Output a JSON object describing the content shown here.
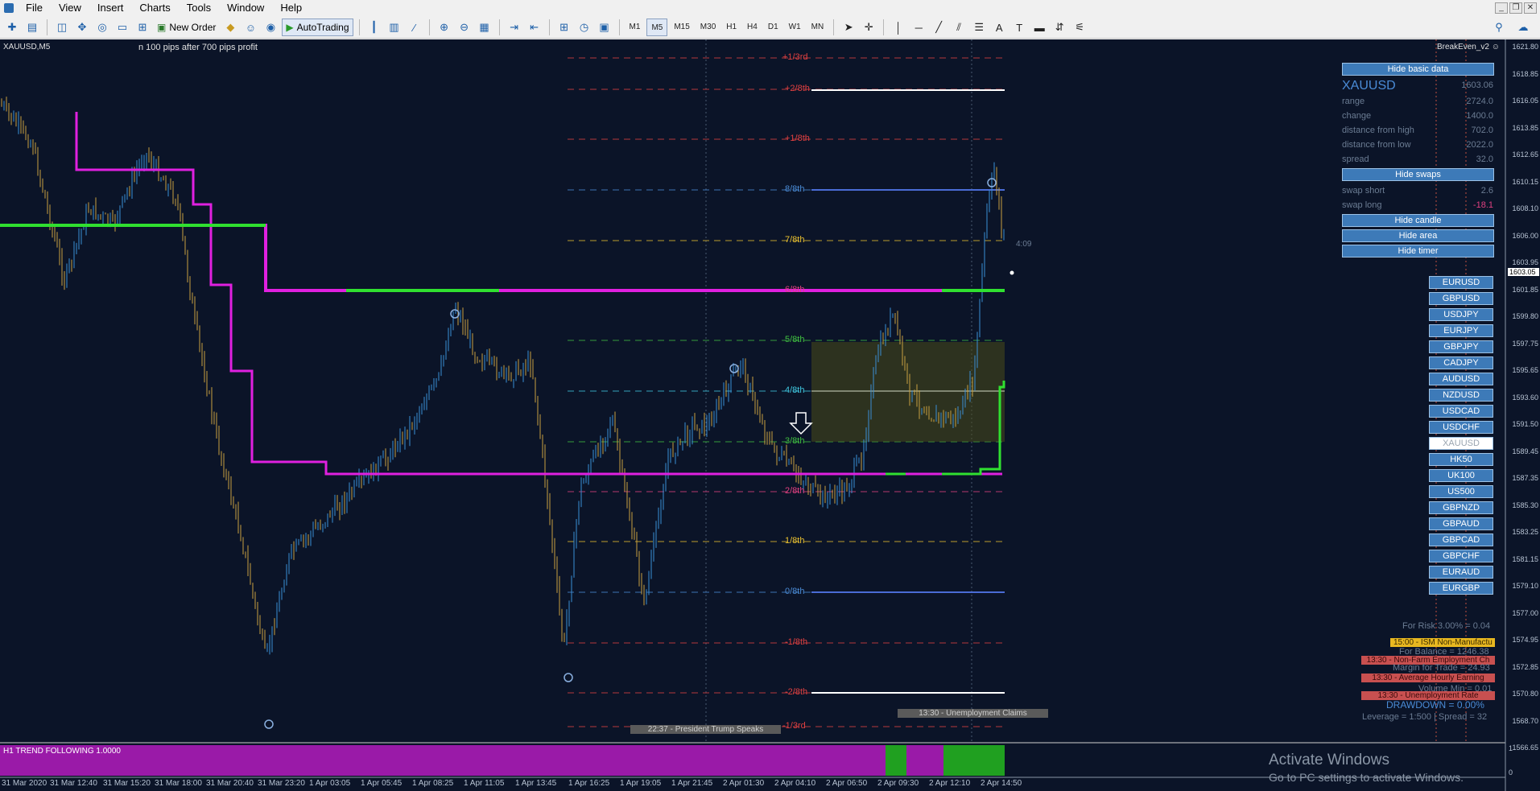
{
  "menu": {
    "items": [
      "File",
      "View",
      "Insert",
      "Charts",
      "Tools",
      "Window",
      "Help"
    ]
  },
  "toolbar": {
    "new_order_label": "New Order",
    "autotrading_label": "AutoTrading",
    "timeframes": [
      "M1",
      "M5",
      "M15",
      "M30",
      "H1",
      "H4",
      "D1",
      "W1",
      "MN"
    ],
    "active_timeframe": "M5",
    "drawing_tool_letter": "A"
  },
  "chart": {
    "symbol_label": "XAUUSD,M5",
    "note": "n 100 pips after 700 pips profit",
    "indicator_name": "BreakEven_v2",
    "candle_timer": "4:09",
    "subwindow_label": "H1 TREND FOLLOWING 1.0000",
    "subwindow_scale_top": "1",
    "subwindow_scale_bottom": "0",
    "price_axis": [
      "1621.80",
      "1618.85",
      "1616.05",
      "1613.85",
      "1612.65",
      "1610.15",
      "1608.10",
      "1606.00",
      "1603.95",
      "1601.85",
      "1599.80",
      "1597.75",
      "1595.65",
      "1593.60",
      "1591.50",
      "1589.45",
      "1587.35",
      "1585.30",
      "1583.25",
      "1581.15",
      "1579.10",
      "1577.00",
      "1574.95",
      "1572.85",
      "1570.80",
      "1568.70",
      "1566.65"
    ],
    "current_price": "1603.05",
    "time_axis": [
      "31 Mar 2020",
      "31 Mar 12:40",
      "31 Mar 15:20",
      "31 Mar 18:00",
      "31 Mar 20:40",
      "31 Mar 23:20",
      "1 Apr 03:05",
      "1 Apr 05:45",
      "1 Apr 08:25",
      "1 Apr 11:05",
      "1 Apr 13:45",
      "1 Apr 16:25",
      "1 Apr 19:05",
      "1 Apr 21:45",
      "2 Apr 01:30",
      "2 Apr 04:10",
      "2 Apr 06:50",
      "2 Apr 09:30",
      "2 Apr 12:10",
      "2 Apr 14:50"
    ],
    "murrey_levels": [
      {
        "label": "+1/3rd",
        "color": "#e04040"
      },
      {
        "label": "+2/8th",
        "color": "#e04040"
      },
      {
        "label": "+1/8th",
        "color": "#e04040"
      },
      {
        "label": "8/8th",
        "color": "#4a8bd6"
      },
      {
        "label": "7/8th",
        "color": "#e8c030"
      },
      {
        "label": "6/8th",
        "color": "#e04080"
      },
      {
        "label": "5/8th",
        "color": "#40c040"
      },
      {
        "label": "4/8th",
        "color": "#40c8e0"
      },
      {
        "label": "3/8th",
        "color": "#40c040"
      },
      {
        "label": "2/8th",
        "color": "#e04080"
      },
      {
        "label": "1/8th",
        "color": "#e8c030"
      },
      {
        "label": "0/8th",
        "color": "#4a8bd6"
      },
      {
        "label": "-1/8th",
        "color": "#e04040"
      },
      {
        "label": "-2/8th",
        "color": "#e04040"
      },
      {
        "label": "-1/3rd",
        "color": "#e04040"
      }
    ],
    "news": {
      "trump": "22:37 - President Trump Speaks",
      "claims": "13:30 - Unemployment Claims"
    }
  },
  "info_panel": {
    "hide_basic_label": "Hide basic data",
    "symbol": "XAUUSD",
    "symbol_price": "1603.06",
    "rows": [
      {
        "label": "range",
        "value": "2724.0"
      },
      {
        "label": "change",
        "value": "1400.0"
      },
      {
        "label": "distance from high",
        "value": "702.0"
      },
      {
        "label": "distance from low",
        "value": "2022.0"
      },
      {
        "label": "spread",
        "value": "32.0"
      }
    ],
    "hide_swaps_label": "Hide swaps",
    "swap_short_label": "swap short",
    "swap_short_value": "2.6",
    "swap_long_label": "swap long",
    "swap_long_value": "-18.1",
    "hide_candle_label": "Hide candle",
    "hide_area_label": "Hide area",
    "hide_timer_label": "Hide timer"
  },
  "symbols": {
    "list": [
      "EURUSD",
      "GBPUSD",
      "USDJPY",
      "EURJPY",
      "GBPJPY",
      "CADJPY",
      "AUDUSD",
      "NZDUSD",
      "USDCAD",
      "USDCHF",
      "XAUUSD",
      "HK50",
      "UK100",
      "US500",
      "GBPNZD",
      "GBPAUD",
      "GBPCAD",
      "GBPCHF",
      "EURAUD",
      "EURGBP"
    ],
    "selected": "XAUUSD"
  },
  "risk": {
    "for_risk": "For Risk 3.00% = 0.04",
    "for_balance": "For Balance = 1246.38",
    "margin_for_trade": "Margin for Trade = 24.93",
    "volume_min": "Volume Min = 0.01",
    "drawdown": "DRAWDOWN = 0.00%",
    "leverage": "Leverage = 1:500 | Spread = 32"
  },
  "calendar": [
    {
      "text": "15:00 - ISM Non-Manufactu",
      "color": "#e8b820"
    },
    {
      "text": "13:30 - Non-Farm Employment Ch",
      "color": "#c85050"
    },
    {
      "text": "13:30 - Average Hourly Earning",
      "color": "#c85050"
    },
    {
      "text": "13:30 - Unemployment Rate",
      "color": "#c85050"
    }
  ],
  "watermark": {
    "title": "Activate Windows",
    "subtitle": "Go to PC settings to activate Windows."
  },
  "colors": {
    "chart_bg": "#0b1428",
    "trend_magenta": "#e020e0",
    "trend_green": "#30e030",
    "candle_up": "#3a8fd6",
    "candle_down": "#c8a040"
  }
}
